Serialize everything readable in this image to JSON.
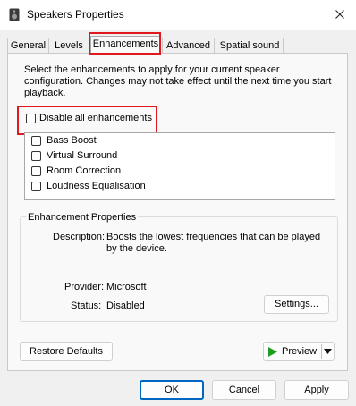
{
  "window": {
    "title": "Speakers Properties"
  },
  "tabs": [
    "General",
    "Levels",
    "Enhancements",
    "Advanced",
    "Spatial sound"
  ],
  "active_tab": "Enhancements",
  "instruction": "Select the enhancements to apply for your current speaker configuration. Changes may not take effect until the next time you start playback.",
  "disable_all": {
    "label": "Disable all enhancements",
    "checked": false
  },
  "enhancements": [
    {
      "label": "Bass Boost",
      "checked": false
    },
    {
      "label": "Virtual Surround",
      "checked": false
    },
    {
      "label": "Room Correction",
      "checked": false
    },
    {
      "label": "Loudness Equalisation",
      "checked": false
    }
  ],
  "properties": {
    "group_title": "Enhancement Properties",
    "description_label": "Description:",
    "description_value": "Boosts the lowest frequencies that can be played by the device.",
    "provider_label": "Provider:",
    "provider_value": "Microsoft",
    "status_label": "Status:",
    "status_value": "Disabled",
    "settings_button": "Settings..."
  },
  "buttons": {
    "restore_defaults": "Restore Defaults",
    "preview": "Preview",
    "ok": "OK",
    "cancel": "Cancel",
    "apply": "Apply"
  },
  "icons": {
    "window_icon": "speaker-icon",
    "close": "close-icon",
    "play": "play-icon",
    "dropdown": "dropdown-arrow-icon"
  },
  "colors": {
    "highlight": "#e0181f",
    "play_green": "#1e9e1e",
    "primary_border": "#0067c0"
  }
}
